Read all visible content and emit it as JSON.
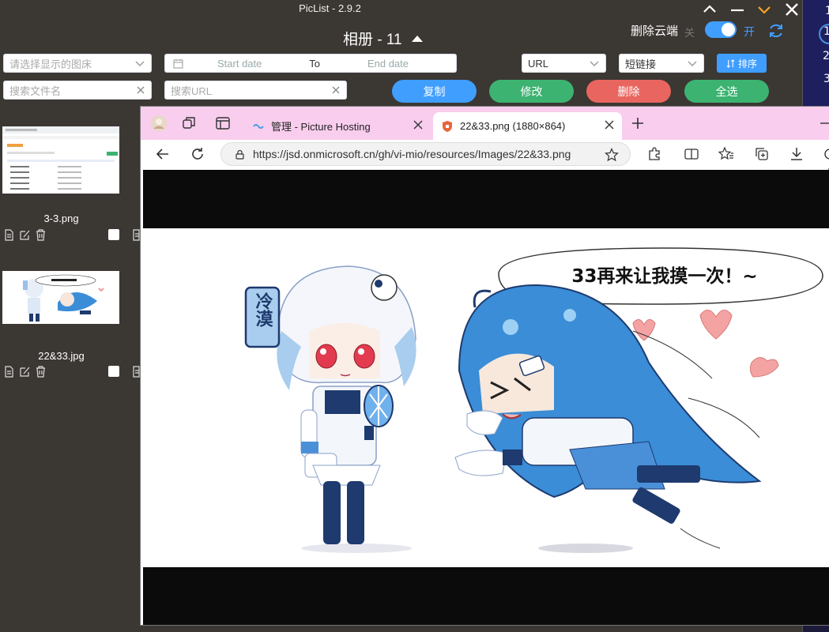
{
  "app": {
    "title": "PicList - 2.9.2",
    "album_title": "相册 - 11",
    "delete_cloud_label": "删除云端",
    "toggle_off_label": "关",
    "toggle_on_label": "开",
    "accent_color": "#409eff"
  },
  "filters": {
    "bed_select_placeholder": "请选择显示的图床",
    "start_date_placeholder": "Start date",
    "date_separator": "To",
    "end_date_placeholder": "End date",
    "format_select_value": "URL",
    "link_select_value": "短链接",
    "sort_button": "排序",
    "search_name_placeholder": "搜索文件名",
    "search_url_placeholder": "搜索URL"
  },
  "actions": {
    "copy": "复制",
    "edit": "修改",
    "delete": "删除",
    "select_all": "全选",
    "colors": {
      "copy": "#409eff",
      "edit": "#3cb371",
      "delete": "#e8665f",
      "select_all": "#3cb371"
    }
  },
  "gallery": [
    {
      "name": "3-3.png"
    },
    {
      "name": "22&33.jpg"
    }
  ],
  "browser": {
    "tabs": [
      {
        "title": "管理 - Picture Hosting",
        "active": false
      },
      {
        "title": "22&33.png (1880×864)",
        "active": true
      }
    ],
    "url": "https://jsd.onmicrosoft.cn/gh/vi-mio/resources/Images/22&33.png",
    "tabbar_color": "#f9cdee"
  },
  "image": {
    "speech_text": "33再来让我摸一次！~",
    "sign_text": "冷漠"
  },
  "desktop": {
    "edge_chars": [
      "1",
      "1",
      "2",
      "3"
    ]
  }
}
